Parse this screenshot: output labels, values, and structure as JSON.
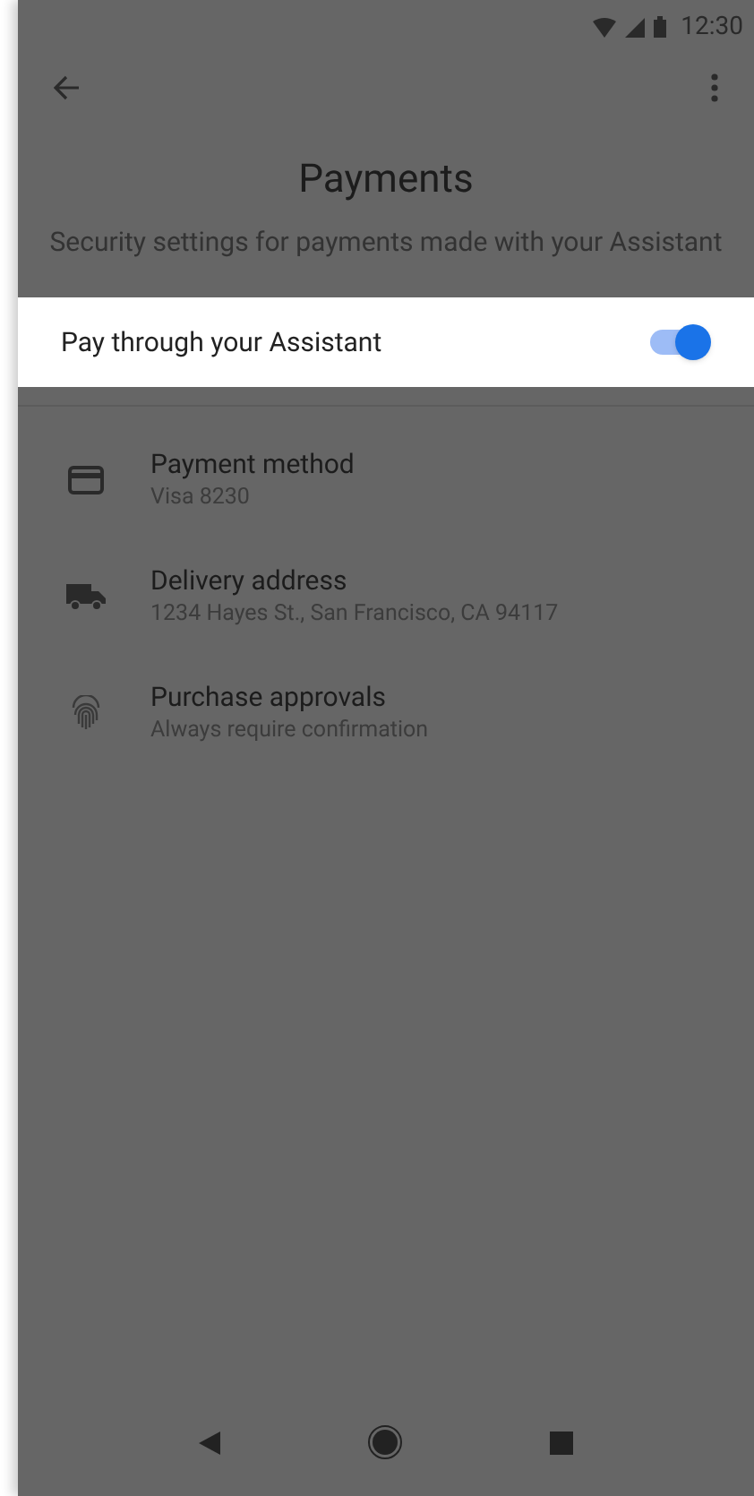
{
  "status_bar": {
    "time": "12:30"
  },
  "header": {
    "title": "Payments",
    "subtitle": "Security settings for payments made with your Assistant"
  },
  "toggle_row": {
    "label": "Pay through your Assistant",
    "on": true
  },
  "items": [
    {
      "kind": "card",
      "title": "Payment method",
      "subtitle": "Visa 8230"
    },
    {
      "kind": "truck",
      "title": "Delivery address",
      "subtitle": "1234 Hayes St., San Francisco, CA 94117"
    },
    {
      "kind": "fingerprint",
      "title": "Purchase approvals",
      "subtitle": "Always require confirmation"
    }
  ]
}
